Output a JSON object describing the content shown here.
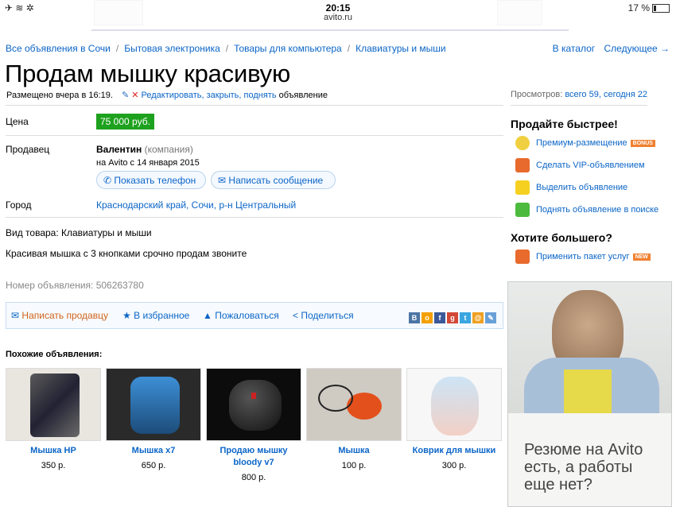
{
  "status": {
    "left": "✈ ≋ ✲",
    "time": "20:15",
    "url": "avito.ru",
    "battery": "17 %"
  },
  "breadcrumbs": [
    "Все объявления в Сочи",
    "Бытовая электроника",
    "Товары для компьютера",
    "Клавиатуры и мыши"
  ],
  "topnav": {
    "catalog": "В каталог",
    "next": "Следующее →"
  },
  "title": "Продам мышку красивую",
  "posted": {
    "text": "Размещено вчера в 16:19.",
    "actions": "Редактировать, закрыть, поднять",
    "suffix": "объявление"
  },
  "views": {
    "label": "Просмотров:",
    "value": "всего 59, сегодня 22"
  },
  "labels": {
    "price": "Цена",
    "seller": "Продавец",
    "city": "Город"
  },
  "price": "75 000 руб.",
  "seller": {
    "name": "Валентин",
    "type": "(компания)",
    "since": "на Avito с 14 января 2015"
  },
  "buttons": {
    "phone": "Показать телефон",
    "message": "Написать сообщение"
  },
  "city": "Краснодарский край, Сочи, р-н Центральный",
  "type_line": "Вид товара: Клавиатуры и мыши",
  "description": "Красивая мышка с 3 кнопками срочно продам звоните",
  "ad_number": "Номер объявления: 506263780",
  "actions": {
    "write": "Написать продавцу",
    "fav": "В избранное",
    "complain": "Пожаловаться",
    "share": "Поделиться"
  },
  "similar_title": "Похожие объявления:",
  "similar": [
    {
      "title": "Мышка HP",
      "price": "350 р."
    },
    {
      "title": "Мышка x7",
      "price": "650 р."
    },
    {
      "title": "Продаю мышку bloody v7",
      "price": "800 р."
    },
    {
      "title": "Мышка",
      "price": "100 р."
    },
    {
      "title": "Коврик для мышки",
      "price": "300 р."
    }
  ],
  "sell_faster": {
    "title": "Продайте быстрее!",
    "premium": "Премиум-размещение",
    "bonus": "BONUS",
    "vip": "Сделать VIP-объявлением",
    "highlight": "Выделить объявление",
    "raise": "Поднять объявление в поиске"
  },
  "want_more": {
    "title": "Хотите большего?",
    "package": "Применить пакет услуг",
    "new": "NEW"
  },
  "banner": {
    "line1": "Резюме на Avito",
    "line2": "есть, а работы",
    "line3": "еще нет?"
  },
  "colors": {
    "link": "#0b65c7",
    "price_bg": "#1ea11e",
    "orange": "#d2621b"
  }
}
